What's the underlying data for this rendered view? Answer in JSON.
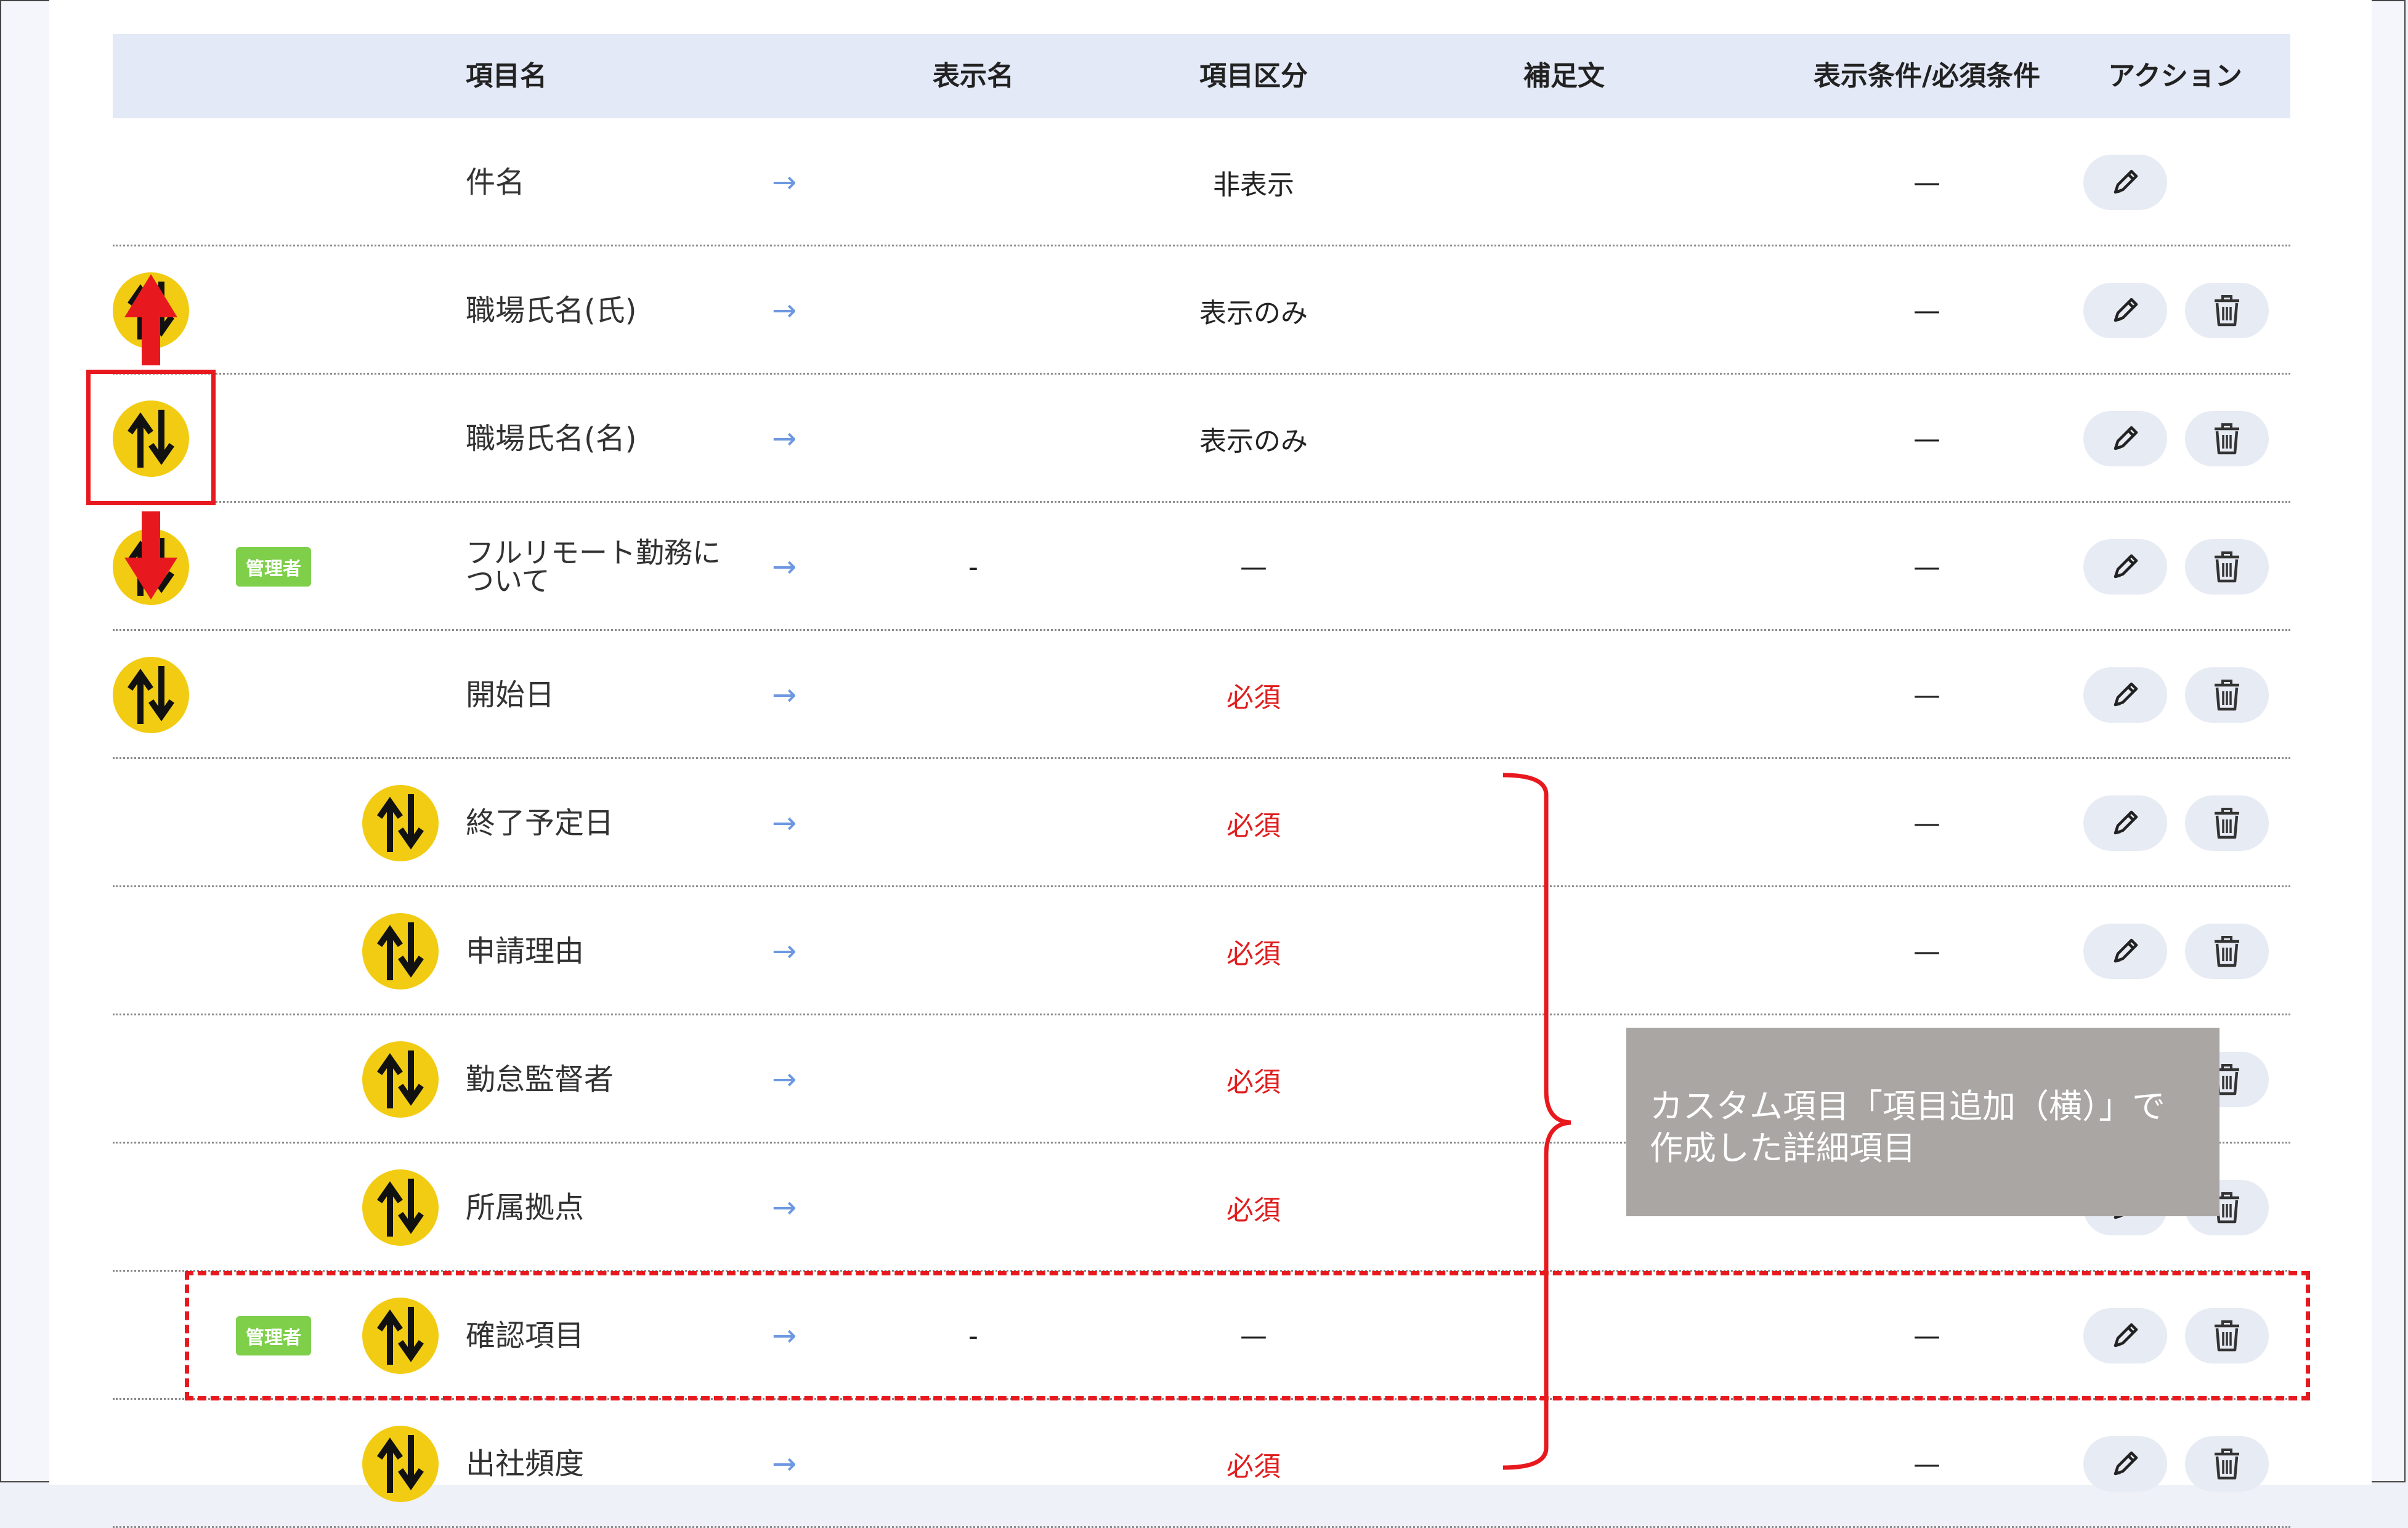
{
  "header": {
    "col_name": "項目名",
    "col_display": "表示名",
    "col_kubun": "項目区分",
    "col_note": "補足文",
    "col_cond": "表示条件/必須条件",
    "col_action": "アクション"
  },
  "rows": [
    {
      "name": "件名",
      "display": "",
      "kubun": "非表示",
      "cond": "—",
      "badge": "",
      "reorder": "",
      "required": false,
      "delete": false
    },
    {
      "name": "職場氏名(氏)",
      "display": "",
      "kubun": "表示のみ",
      "cond": "—",
      "badge": "",
      "reorder": "outer",
      "required": false,
      "delete": true
    },
    {
      "name": "職場氏名(名)",
      "display": "",
      "kubun": "表示のみ",
      "cond": "—",
      "badge": "",
      "reorder": "outer",
      "required": false,
      "delete": true
    },
    {
      "name": "フルリモート勤務について",
      "name_line1": "フルリモート勤務に",
      "name_line2": "ついて",
      "display": "-",
      "kubun": "—",
      "cond": "—",
      "badge": "管理者",
      "reorder": "outer",
      "required": false,
      "delete": true
    },
    {
      "name": "開始日",
      "display": "",
      "kubun": "必須",
      "cond": "—",
      "badge": "",
      "reorder": "outer",
      "required": true,
      "delete": true
    },
    {
      "name": "終了予定日",
      "display": "",
      "kubun": "必須",
      "cond": "—",
      "badge": "",
      "reorder": "inner",
      "required": true,
      "delete": true
    },
    {
      "name": "申請理由",
      "display": "",
      "kubun": "必須",
      "cond": "—",
      "badge": "",
      "reorder": "inner",
      "required": true,
      "delete": true
    },
    {
      "name": "勤怠監督者",
      "display": "",
      "kubun": "必須",
      "cond": "",
      "badge": "",
      "reorder": "inner",
      "required": true,
      "delete": true
    },
    {
      "name": "所属拠点",
      "display": "",
      "kubun": "必須",
      "cond": "",
      "badge": "",
      "reorder": "inner",
      "required": true,
      "delete": true
    },
    {
      "name": "確認項目",
      "display": "-",
      "kubun": "—",
      "cond": "—",
      "badge": "管理者",
      "reorder": "inner",
      "required": false,
      "delete": true
    },
    {
      "name": "出社頻度",
      "display": "",
      "kubun": "必須",
      "cond": "—",
      "badge": "",
      "reorder": "inner",
      "required": true,
      "delete": true
    }
  ],
  "callout": {
    "line1": "カスタム項目「項目追加（横）」で",
    "line2": "作成した詳細項目"
  },
  "icons": {
    "reorder": "up-down-arrows-icon",
    "next": "arrow-right-icon",
    "edit": "pencil-icon",
    "delete": "trash-icon"
  },
  "colors": {
    "header_bg": "#e3e9f6",
    "reorder_yellow": "#f2cc13",
    "required_red": "#e01e1e",
    "badge_green": "#7fcf4b",
    "annotation_red": "#e8191e",
    "callout_gray": "#a9a6a4"
  }
}
